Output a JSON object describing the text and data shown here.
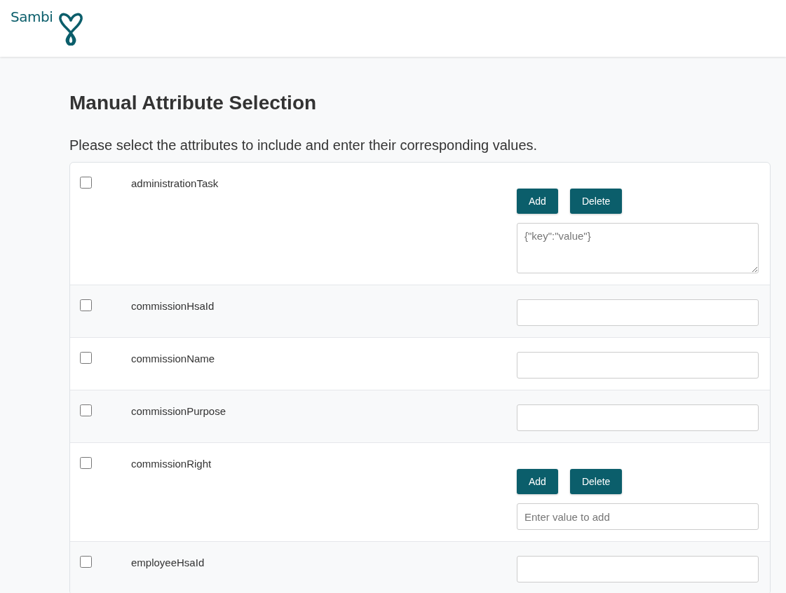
{
  "header": {
    "logo_text": "Sambi"
  },
  "title": "Manual Attribute Selection",
  "subtitle": "Please select the attributes to include and enter their corresponding values.",
  "rows": [
    {
      "kind": "multi-textarea",
      "name": "administrationTask",
      "checked": false,
      "buttons": [
        "Add",
        "Delete"
      ],
      "placeholder": "{\"key\":\"value\"}"
    },
    {
      "kind": "text",
      "name": "commissionHsaId",
      "checked": false
    },
    {
      "kind": "text",
      "name": "commissionName",
      "checked": false
    },
    {
      "kind": "text",
      "name": "commissionPurpose",
      "checked": false
    },
    {
      "kind": "multi-input",
      "name": "commissionRight",
      "checked": false,
      "buttons": [
        "Add",
        "Delete"
      ],
      "placeholder": "Enter value to add"
    },
    {
      "kind": "text",
      "name": "employeeHsaId",
      "checked": false
    }
  ]
}
